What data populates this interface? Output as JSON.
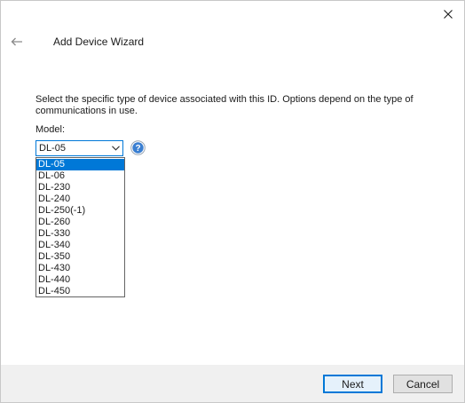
{
  "dialog": {
    "title": "Add Device Wizard",
    "close_icon": "close-icon",
    "back_icon": "back-arrow-icon"
  },
  "content": {
    "instructions": "Select the specific type of device associated with this ID. Options depend on the type of communications in use.",
    "model_label": "Model:",
    "selected_model": "DL-05",
    "help_icon": "help-icon"
  },
  "dropdown": {
    "items": [
      "DL-05",
      "DL-06",
      "DL-230",
      "DL-240",
      "DL-250(-1)",
      "DL-260",
      "DL-330",
      "DL-340",
      "DL-350",
      "DL-430",
      "DL-440",
      "DL-450"
    ]
  },
  "footer": {
    "next_label": "Next",
    "cancel_label": "Cancel"
  },
  "colors": {
    "accent": "#0078d7",
    "footer_bg": "#f0f0f0"
  }
}
